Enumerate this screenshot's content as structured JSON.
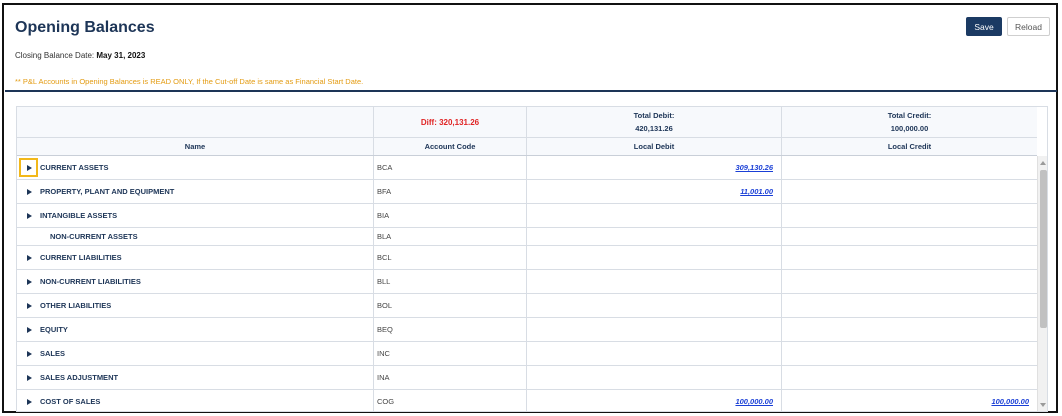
{
  "header": {
    "title": "Opening Balances",
    "closing_label": "Closing Balance Date:",
    "closing_date": "May 31, 2023",
    "notice": "** P&L Accounts in Opening Balances is READ ONLY, If the Cut-off Date is same as Financial Start Date.",
    "save_label": "Save",
    "reload_label": "Reload"
  },
  "summary": {
    "diff": "Diff: 320,131.26",
    "total_debit_label": "Total Debit:",
    "total_debit": "420,131.26",
    "total_credit_label": "Total Credit:",
    "total_credit": "100,000.00"
  },
  "columns": [
    "Name",
    "Account Code",
    "Local Debit",
    "Local Credit"
  ],
  "rows": [
    {
      "name": "CURRENT ASSETS",
      "code": "BCA",
      "debit": "309,130.26",
      "credit": ""
    },
    {
      "name": "PROPERTY, PLANT AND EQUIPMENT",
      "code": "BFA",
      "debit": "11,001.00",
      "credit": ""
    },
    {
      "name": "INTANGIBLE ASSETS",
      "code": "BIA",
      "debit": "",
      "credit": ""
    },
    {
      "name": "NON-CURRENT ASSETS",
      "code": "BLA",
      "debit": "",
      "credit": ""
    },
    {
      "name": "CURRENT LIABILITIES",
      "code": "BCL",
      "debit": "",
      "credit": ""
    },
    {
      "name": "NON-CURRENT LIABILITIES",
      "code": "BLL",
      "debit": "",
      "credit": ""
    },
    {
      "name": "OTHER LIABILITIES",
      "code": "BOL",
      "debit": "",
      "credit": ""
    },
    {
      "name": "EQUITY",
      "code": "BEQ",
      "debit": "",
      "credit": ""
    },
    {
      "name": "SALES",
      "code": "INC",
      "debit": "",
      "credit": ""
    },
    {
      "name": "SALES ADJUSTMENT",
      "code": "INA",
      "debit": "",
      "credit": ""
    },
    {
      "name": "COST OF SALES",
      "code": "COG",
      "debit": "100,000.00",
      "credit": "100,000.00"
    }
  ]
}
